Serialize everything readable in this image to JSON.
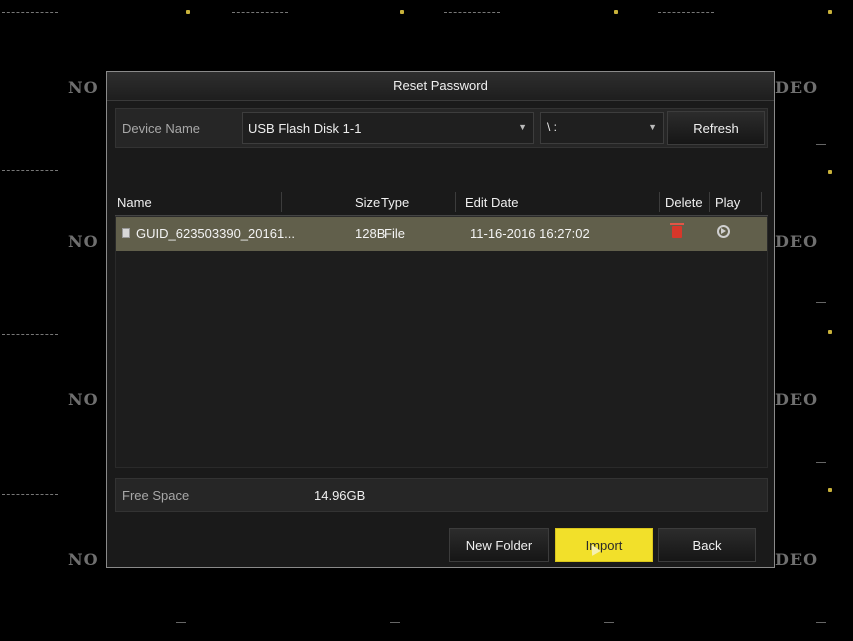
{
  "background": {
    "tile_label": "NO VIDEO",
    "left_fragment": "NO",
    "right_fragment": "DEO"
  },
  "dialog": {
    "title": "Reset Password",
    "device": {
      "label": "Device Name",
      "value": "USB Flash Disk 1-1",
      "path_value": "\\ :"
    },
    "refresh_label": "Refresh",
    "table": {
      "columns": [
        "Name",
        "Size",
        "Type",
        "Edit Date",
        "Delete",
        "Play"
      ],
      "rows": [
        {
          "name": "GUID_623503390_20161...",
          "size": "128B",
          "type": "File",
          "edit_date": "11-16-2016 16:27:02",
          "delete_icon": "trash-icon",
          "play_icon": "play-circle-icon"
        }
      ]
    },
    "free_space": {
      "label": "Free Space",
      "value": "14.96GB"
    },
    "buttons": {
      "new_folder": "New Folder",
      "import": "Import",
      "back": "Back"
    }
  },
  "colors": {
    "selected_row": "#615f4b",
    "import_button": "#f2e02a",
    "delete_icon": "#d7372a"
  }
}
